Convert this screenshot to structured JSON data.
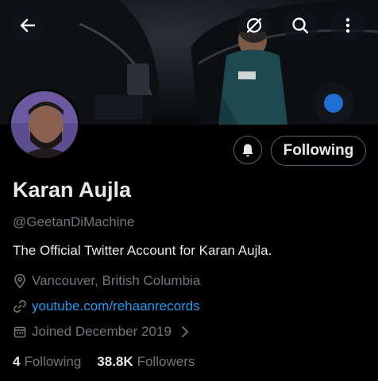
{
  "header": {
    "back_icon": "arrow-left-icon",
    "grok_icon": "grok-icon",
    "search_icon": "search-icon",
    "more_icon": "more-vertical-icon"
  },
  "profile": {
    "name": "Karan Aujla",
    "handle": "@GeetanDiMachine",
    "bio": "The Official Twitter Account for Karan Aujla.",
    "location": "Vancouver, British Columbia",
    "website": "youtube.com/rehaanrecords",
    "joined": "Joined December 2019"
  },
  "actions": {
    "notify_icon": "bell-notification-icon",
    "following_label": "Following"
  },
  "stats": {
    "following_count": "4",
    "following_label": "Following",
    "followers_count": "38.8K",
    "followers_label": "Followers"
  },
  "colors": {
    "background": "#000000",
    "text_primary": "#e7e9ea",
    "text_secondary": "#71767b",
    "link": "#1d9bf0",
    "border": "#536471"
  }
}
